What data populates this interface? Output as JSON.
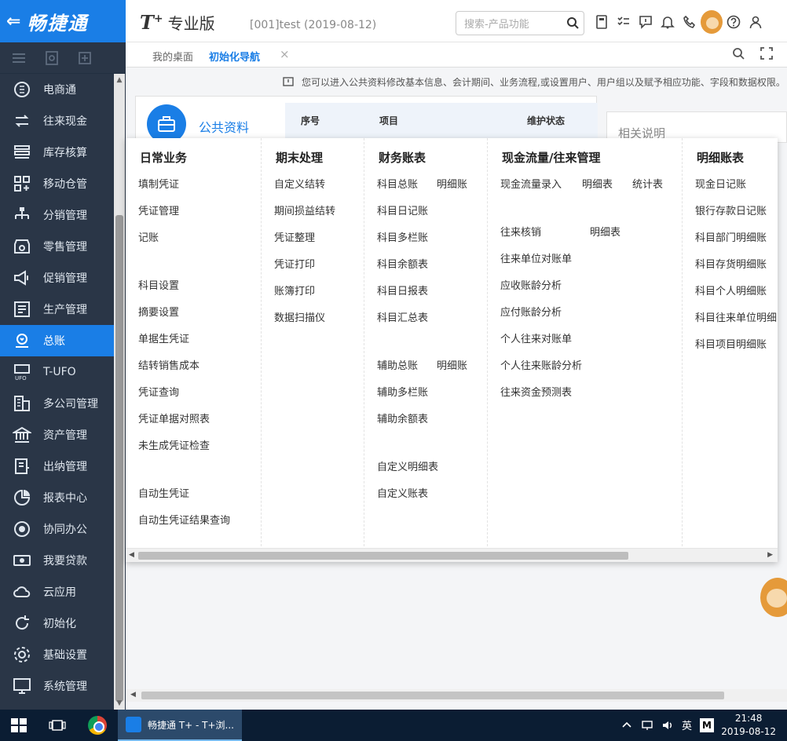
{
  "brand": {
    "back": "⇐",
    "name": "畅捷通"
  },
  "product": {
    "logo": "T",
    "plus": "+",
    "edition": "专业版"
  },
  "account": "[001]test  (2019-08-12)",
  "search": {
    "placeholder": "搜索-产品功能"
  },
  "sidebar": {
    "items": [
      {
        "label": "电商通",
        "icon": "circle-letter-icon"
      },
      {
        "label": "往来现金",
        "icon": "transfer-icon"
      },
      {
        "label": "库存核算",
        "icon": "inventory-icon"
      },
      {
        "label": "移动仓管",
        "icon": "grid-plus-icon"
      },
      {
        "label": "分销管理",
        "icon": "org-tree-icon"
      },
      {
        "label": "零售管理",
        "icon": "store-icon"
      },
      {
        "label": "促销管理",
        "icon": "megaphone-icon"
      },
      {
        "label": "生产管理",
        "icon": "production-icon"
      },
      {
        "label": "总账",
        "icon": "ledger-icon",
        "active": true
      },
      {
        "label": "T-UFO",
        "icon": "ufo-icon"
      },
      {
        "label": "多公司管理",
        "icon": "building-icon"
      },
      {
        "label": "资产管理",
        "icon": "bank-icon"
      },
      {
        "label": "出纳管理",
        "icon": "cashier-icon"
      },
      {
        "label": "报表中心",
        "icon": "pie-chart-icon"
      },
      {
        "label": "协同办公",
        "icon": "collaborate-icon"
      },
      {
        "label": "我要贷款",
        "icon": "cash-icon"
      },
      {
        "label": "云应用",
        "icon": "cloud-icon"
      },
      {
        "label": "初始化",
        "icon": "refresh-icon"
      },
      {
        "label": "基础设置",
        "icon": "settings-icon"
      },
      {
        "label": "系统管理",
        "icon": "monitor-icon"
      }
    ]
  },
  "tabs": {
    "desk": "我的桌面",
    "init": "初始化导航",
    "close": "×"
  },
  "info": "您可以进入公共资料修改基本信息、会计期间、业务流程,或设置用户、用户组以及赋予相应功能、字段和数据权限。",
  "public": {
    "title": "公共资料",
    "col_seq": "序号",
    "col_item": "项目",
    "col_status": "维护状态",
    "related": "相关说明"
  },
  "menu": {
    "daily": {
      "title": "日常业务",
      "items": [
        "填制凭证",
        "凭证管理",
        "记账",
        "科目设置",
        "摘要设置",
        "单据生凭证",
        "结转销售成本",
        "凭证查询",
        "凭证单据对照表",
        "未生成凭证检查",
        "自动生凭证",
        "自动生凭证结果查询"
      ]
    },
    "period": {
      "title": "期末处理",
      "items": [
        "自定义结转",
        "期间损益结转",
        "凭证整理",
        "凭证打印",
        "账簿打印",
        "数据扫描仪"
      ]
    },
    "finance": {
      "title": "财务账表",
      "items": [
        "科目总账",
        "明细账",
        "科目日记账",
        "科目多栏账",
        "科目余额表",
        "科目日报表",
        "科目汇总表",
        "辅助总账",
        "明细账",
        "辅助多栏账",
        "辅助余额表",
        "自定义明细表",
        "自定义账表"
      ]
    },
    "cash": {
      "title": "现金流量/往来管理",
      "items": [
        "现金流量录入",
        "明细表",
        "统计表",
        "往来核销",
        "明细表",
        "往来单位对账单",
        "应收账龄分析",
        "应付账龄分析",
        "个人往来对账单",
        "个人往来账龄分析",
        "往来资金预测表"
      ]
    },
    "detail": {
      "title": "明细账表",
      "items": [
        "现金日记账",
        "银行存款日记账",
        "科目部门明细账",
        "科目存货明细账",
        "科目个人明细账",
        "科目往来单位明细",
        "科目项目明细账"
      ]
    }
  },
  "taskbar": {
    "app": "畅捷通 T+ - T+浏...",
    "ime": "英",
    "m": "M",
    "time": "21:48",
    "date": "2019-08-12"
  },
  "colors": {
    "accent": "#1a7ee6",
    "sidebar": "#2a3647",
    "taskbar": "#0b1d33"
  }
}
